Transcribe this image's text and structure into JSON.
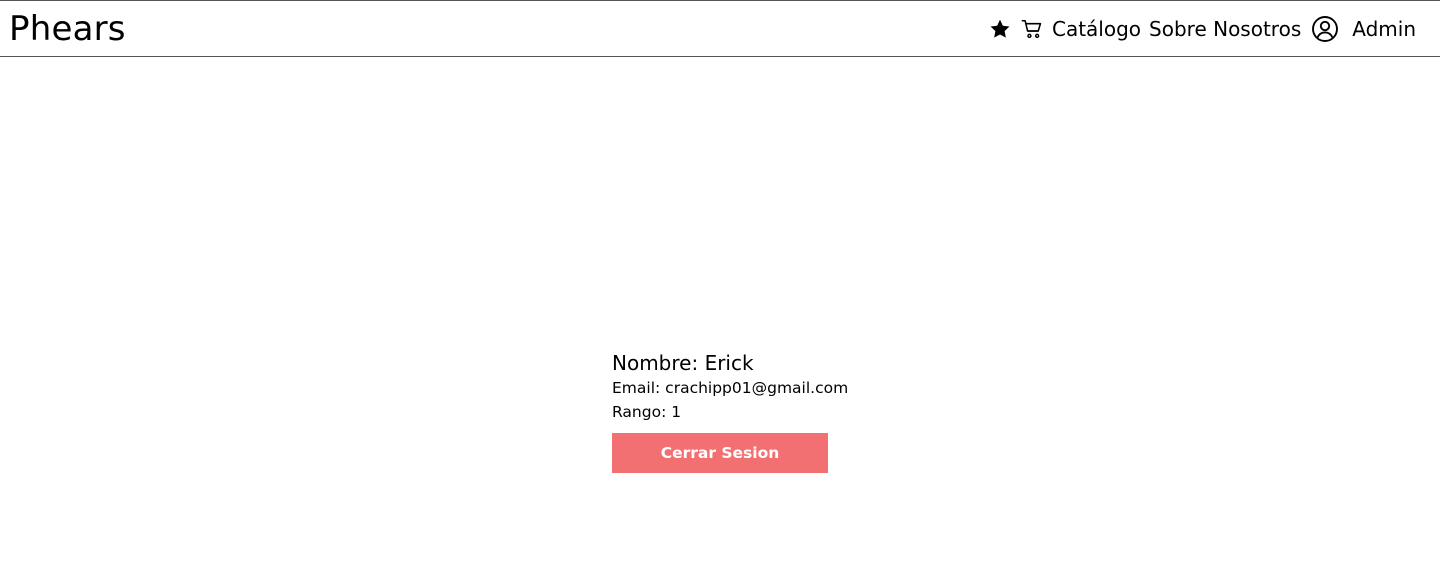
{
  "header": {
    "brand": "Phears",
    "icons": {
      "favorites": "star-icon",
      "cart": "cart-icon",
      "account": "user-circle-icon"
    },
    "nav": {
      "catalog": "Catálogo",
      "about": "Sobre Nosotros",
      "admin": "Admin"
    }
  },
  "profile": {
    "name_label": "Nombre:",
    "name_value": "Erick",
    "email_label": "Email:",
    "email_value": "crachipp01@gmail.com",
    "rank_label": "Rango:",
    "rank_value": "1",
    "logout_label": "Cerrar Sesion"
  },
  "colors": {
    "logout_button": "#f27072",
    "header_border": "#555555"
  }
}
